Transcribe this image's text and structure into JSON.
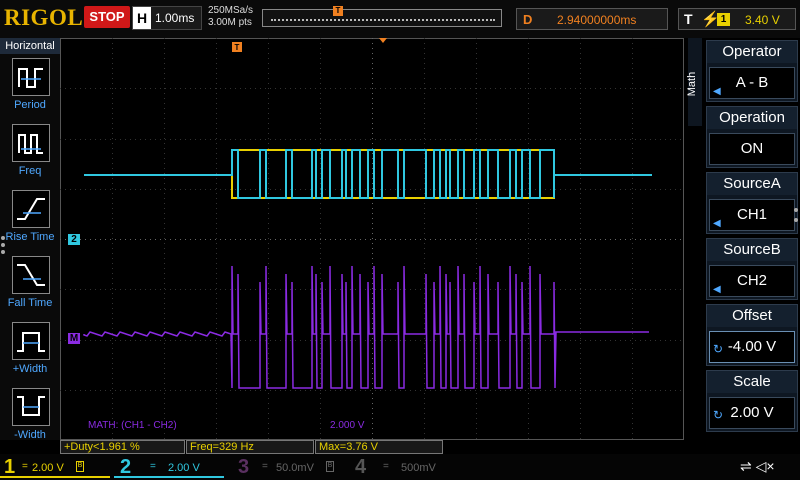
{
  "brand": "RIGOL",
  "run_state": "STOP",
  "horizontal": {
    "key": "H",
    "timebase": "1.00ms",
    "sample_rate": "250MSa/s",
    "memory_depth": "3.00M pts"
  },
  "delay": {
    "key": "D",
    "value": "2.94000000ms"
  },
  "trigger": {
    "key": "T",
    "edge_icon": "rising-edge-icon",
    "source": "1",
    "level": "3.40 V"
  },
  "left_menu": {
    "title": "Horizontal",
    "items": [
      {
        "label": "Period",
        "icon": "period-icon"
      },
      {
        "label": "Freq",
        "icon": "frequency-icon"
      },
      {
        "label": "Rise Time",
        "icon": "rise-time-icon"
      },
      {
        "label": "Fall Time",
        "icon": "fall-time-icon"
      },
      {
        "label": "+Width",
        "icon": "positive-width-icon"
      },
      {
        "label": "-Width",
        "icon": "negative-width-icon"
      }
    ]
  },
  "right_menu": {
    "side_tab": "Math",
    "panels": [
      {
        "header": "Operator",
        "value": "A - B"
      },
      {
        "header": "Operation",
        "value": "ON"
      },
      {
        "header": "SourceA",
        "value": "CH1"
      },
      {
        "header": "SourceB",
        "value": "CH2"
      },
      {
        "header": "Offset",
        "value": "-4.00 V"
      },
      {
        "header": "Scale",
        "value": "2.00 V"
      }
    ]
  },
  "screen": {
    "math_label": "MATH: (CH1 - CH2)",
    "math_scale": "2.000 V",
    "marker_ch2": "2",
    "marker_math": "M",
    "marker_trigger": "T"
  },
  "measurements": [
    {
      "text": "+Duty<1.961 %"
    },
    {
      "text": "Freq=329 Hz"
    },
    {
      "text": "Max=3.76 V"
    }
  ],
  "channels": [
    {
      "num": "1",
      "scale": "2.00 V",
      "color": "#e8d000",
      "coupling": "=",
      "bw": "B"
    },
    {
      "num": "2",
      "scale": "2.00 V",
      "color": "#30c8e0",
      "coupling": "="
    },
    {
      "num": "3",
      "scale": "50.0mV",
      "color": "#a040c0",
      "coupling": "=",
      "bw": "B"
    },
    {
      "num": "4",
      "scale": "500mV",
      "color": "#4060c0",
      "coupling": "="
    }
  ],
  "colors": {
    "ch1": "#e8d000",
    "ch2": "#30c8e0",
    "math": "#8a2be2",
    "trigger": "#f08020"
  }
}
